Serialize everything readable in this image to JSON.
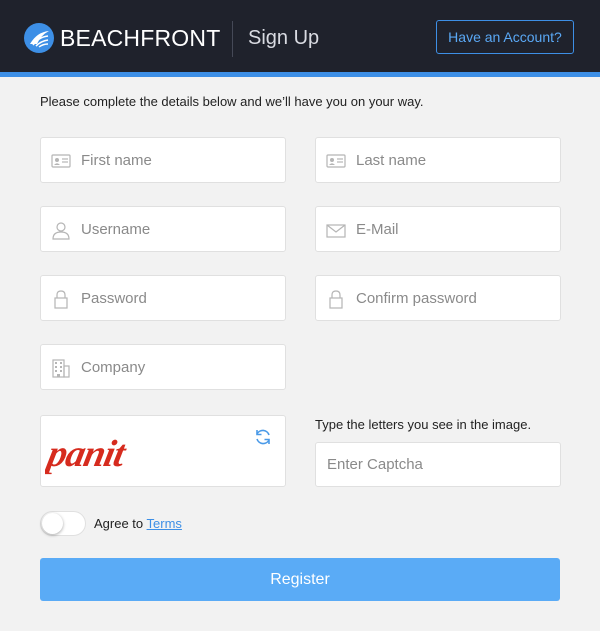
{
  "header": {
    "brand": "BEACHFRONT",
    "title": "Sign Up",
    "account_button": "Have an Account?"
  },
  "intro": "Please complete the details below and we’ll have you on your way.",
  "form": {
    "first_name": {
      "placeholder": "First name",
      "value": "",
      "icon": "id-card-icon"
    },
    "last_name": {
      "placeholder": "Last name",
      "value": "",
      "icon": "id-card-icon"
    },
    "username": {
      "placeholder": "Username",
      "value": "",
      "icon": "user-icon"
    },
    "email": {
      "placeholder": "E-Mail",
      "value": "",
      "icon": "envelope-icon"
    },
    "password": {
      "placeholder": "Password",
      "value": "",
      "icon": "lock-icon"
    },
    "confirm_password": {
      "placeholder": "Confirm password",
      "value": "",
      "icon": "lock-icon"
    },
    "company": {
      "placeholder": "Company",
      "value": "",
      "icon": "building-icon"
    }
  },
  "captcha": {
    "image_text": "panit",
    "hint": "Type the letters you see in the image.",
    "placeholder": "Enter Captcha",
    "value": "",
    "refresh_icon": "refresh-icon"
  },
  "terms": {
    "prefix": "Agree to",
    "link": "Terms",
    "agreed": false
  },
  "register_label": "Register",
  "colors": {
    "header_bg": "#1f222c",
    "accent": "#3d8fe6",
    "register_bg": "#5aabf6",
    "page_bg": "#f2f2f2",
    "captcha_text": "#d62b1e"
  }
}
